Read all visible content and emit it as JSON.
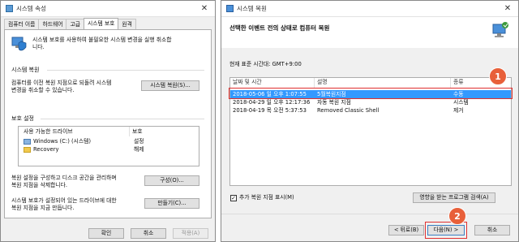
{
  "left_window": {
    "title": "시스템 속성",
    "tabs": [
      "컴퓨터 이름",
      "하드웨어",
      "고급",
      "시스템 보호",
      "원격"
    ],
    "active_tab_index": 3,
    "intro_text_1": "시스템 보호를 사용하여 불필요한 시스템 변경을 실행 취소합",
    "intro_text_2": "니다.",
    "restore_group_label": "시스템 복원",
    "restore_desc_1": "컴퓨터를 이전 복원 지점으로 되돌려 시스템",
    "restore_desc_2": "변경을 취소할 수 있습니다.",
    "restore_button": "시스템 복원(S)...",
    "protect_group_label": "보호 설정",
    "drives_header": [
      "사용 가능한 드라이브",
      "보호"
    ],
    "drives": [
      {
        "name": "Windows (C:) (시스템)",
        "protection": "설정"
      },
      {
        "name": "Recovery",
        "protection": "해제"
      }
    ],
    "configure_desc_1": "복원 설정을 구성하고 디스크 공간을 관리하며",
    "configure_desc_2": "복원 지점을 삭제합니다.",
    "configure_button": "구성(O)...",
    "create_desc_1": "시스템 보호가 설정되어 있는 드라이브에 대한",
    "create_desc_2": "복원 지점을 지금 만듭니다.",
    "create_button": "만들기(C)...",
    "ok_button": "확인",
    "cancel_button": "취소",
    "apply_button": "적용(A)"
  },
  "right_window": {
    "title": "시스템 복원",
    "heading": "선택한 이벤트 전의 상태로 컴퓨터 복원",
    "timezone": "현재 표준 시간대: GMT+9:00",
    "columns": [
      "날짜 및 시간",
      "설명",
      "종류"
    ],
    "rows": [
      {
        "date": "2018-05-06 일 오후 1:07:55",
        "desc": "5월복원지점",
        "type": "수동",
        "selected": true
      },
      {
        "date": "2018-04-29 일 오후 12:17:36",
        "desc": "자동 복원 지점",
        "type": "시스템",
        "selected": false
      },
      {
        "date": "2018-04-19 목 오전 5:37:53",
        "desc": "Removed Classic Shell",
        "type": "제거",
        "selected": false
      }
    ],
    "show_more_label": "추가 복원 지점 표시(M)",
    "show_more_checked": true,
    "scan_button": "영향을 받는 프로그램 검색(A)",
    "back_button": "< 뒤로(B)",
    "next_button": "다음(N) >",
    "cancel_button": "취소"
  },
  "annotations": {
    "badge_1": "1",
    "badge_2": "2",
    "color": "#e8603a"
  }
}
